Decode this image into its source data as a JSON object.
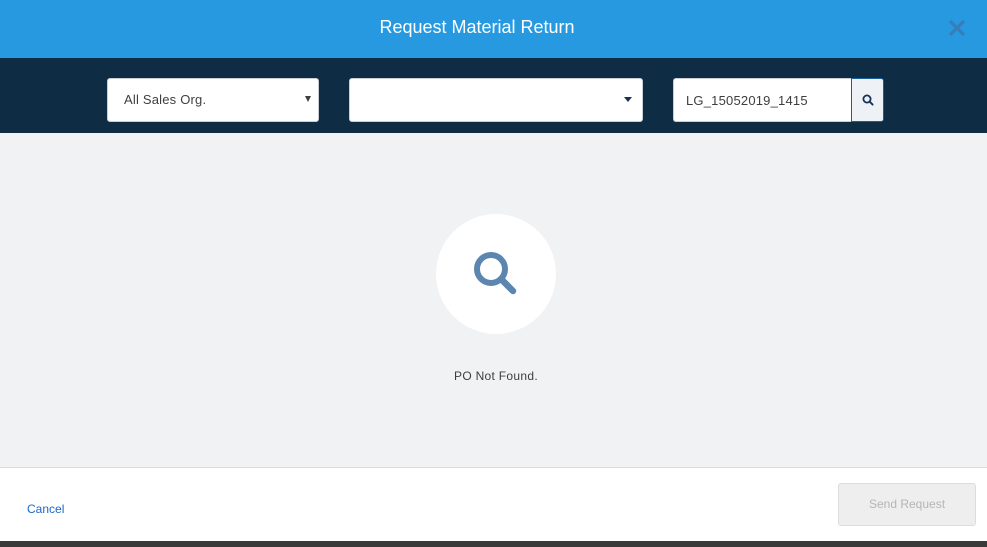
{
  "header": {
    "title": "Request Material Return",
    "close_icon": "close-icon"
  },
  "toolbar": {
    "sales_org": {
      "value": "All Sales Org.",
      "icon": "caret-down-icon"
    },
    "second_select": {
      "value": "",
      "icon": "caret-down-icon"
    },
    "search": {
      "value": "LG_15052019_1415",
      "placeholder": "",
      "icon": "search-icon"
    }
  },
  "empty_state": {
    "icon": "search-icon",
    "message": "PO Not Found."
  },
  "footer": {
    "cancel_label": "Cancel",
    "send_label": "Send Request"
  },
  "colors": {
    "header_bg": "#2699e0",
    "toolbar_bg": "#0f2c45",
    "body_bg": "#f1f2f4",
    "link": "#1b66c9",
    "icon_blue": "#5b86b0"
  }
}
